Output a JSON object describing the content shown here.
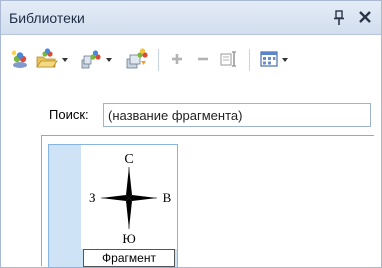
{
  "panel": {
    "title": "Библиотеки",
    "pin_icon": "pin-icon",
    "close_icon": "close-icon"
  },
  "toolbar": {
    "buttons": [
      {
        "name": "new-library-button",
        "icon": "new-library-icon",
        "has_dropdown": false
      },
      {
        "name": "open-library-button",
        "icon": "open-library-icon",
        "has_dropdown": true
      },
      {
        "name": "library-settings-button",
        "icon": "library-settings-icon",
        "has_dropdown": true
      },
      {
        "name": "library-groups-button",
        "icon": "library-groups-icon",
        "has_dropdown": false
      },
      {
        "name": "add-fragment-button",
        "icon": "plus-icon",
        "has_dropdown": false
      },
      {
        "name": "remove-fragment-button",
        "icon": "minus-icon",
        "has_dropdown": false
      },
      {
        "name": "insert-fragment-button",
        "icon": "insert-icon",
        "has_dropdown": false
      },
      {
        "name": "view-mode-button",
        "icon": "view-mode-icon",
        "has_dropdown": true
      }
    ]
  },
  "search": {
    "label": "Поиск:",
    "placeholder": "(название фрагмента)",
    "value": ""
  },
  "fragments": [
    {
      "caption": "Фрагмент",
      "thumbnail": "compass-rose-icon",
      "labels": {
        "north": "С",
        "south": "Ю",
        "west": "З",
        "east": "В"
      }
    }
  ],
  "colors": {
    "title_bg": "#d9e4f2",
    "selection_bg": "#cfe3f7",
    "selection_border": "#88b4e4",
    "icon_green": "#78b83a",
    "icon_yellow": "#f2c43a",
    "icon_red": "#d94b3a"
  }
}
